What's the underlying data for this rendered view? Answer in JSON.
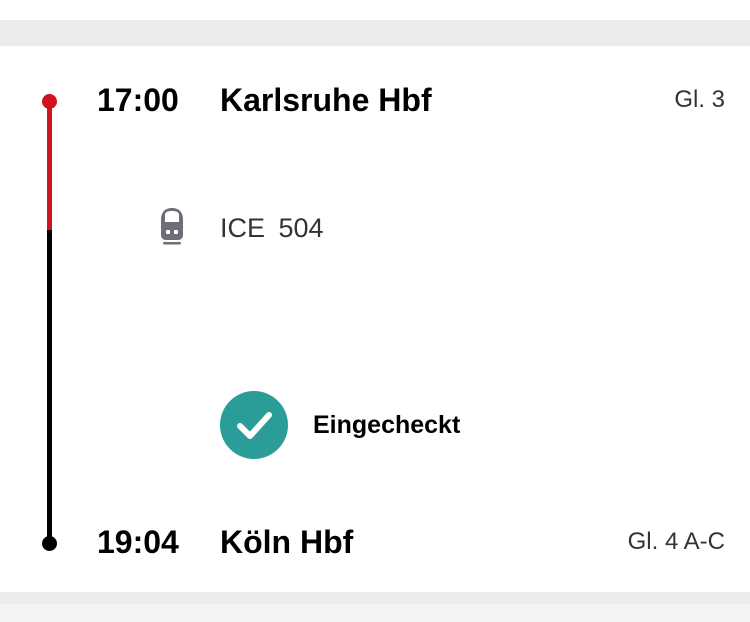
{
  "departure": {
    "time": "17:00",
    "station": "Karlsruhe Hbf",
    "platform": "Gl. 3"
  },
  "train": {
    "icon": "train-icon",
    "label": "ICE  504"
  },
  "checkin": {
    "icon": "checkmark-circle-icon",
    "label": "Eingecheckt",
    "color": "#2a9d99"
  },
  "arrival": {
    "time": "19:04",
    "station": "Köln Hbf",
    "platform": "Gl. 4 A-C"
  },
  "colors": {
    "timeline_active": "#cf1420",
    "timeline_rest": "#000000"
  }
}
